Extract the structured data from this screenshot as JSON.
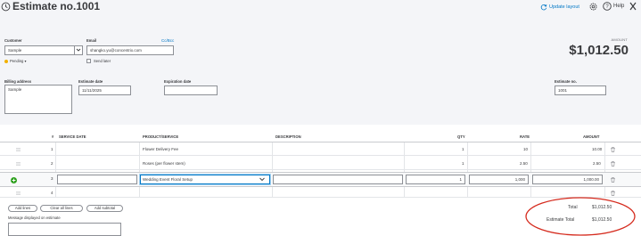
{
  "header": {
    "title": "Estimate no.1001",
    "update_layout": "Update layout",
    "help": "Help"
  },
  "form": {
    "customer_label": "Customer",
    "customer_value": "Sample",
    "email_label": "Email",
    "email_value": "shangko.yu@concentrix.com",
    "cc_bcc": "Cc/Bcc",
    "status": "Pending",
    "send_later": "Send later",
    "amount_label": "AMOUNT",
    "amount_value": "$1,012.50",
    "billing_label": "Billing address",
    "billing_value": "Sample",
    "estimate_date_label": "Estimate date",
    "estimate_date_value": "11/11/2025",
    "expiration_label": "Expiration date",
    "expiration_value": "",
    "estimate_no_label": "Estimate no.",
    "estimate_no_value": "1001"
  },
  "table": {
    "headers": {
      "num": "#",
      "service_date": "SERVICE DATE",
      "product": "PRODUCT/SERVICE",
      "description": "DESCRIPTION",
      "qty": "QTY",
      "rate": "RATE",
      "amount": "AMOUNT"
    },
    "rows": [
      {
        "num": "1",
        "product": "Flower Delivery Fee",
        "qty": "1",
        "rate": "10",
        "amount": "10.00"
      },
      {
        "num": "2",
        "product": "Roses (per flower stem)",
        "qty": "1",
        "rate": "2.50",
        "amount": "2.50"
      },
      {
        "num": "3",
        "product": "Wedding Event Floral Setup",
        "qty": "1",
        "rate": "1,000",
        "amount": "1,000.00"
      },
      {
        "num": "4",
        "product": "",
        "qty": "",
        "rate": "",
        "amount": ""
      }
    ]
  },
  "buttons": {
    "add_lines": "Add lines",
    "clear_all_lines": "Clear all lines",
    "add_subtotal": "Add subtotal"
  },
  "message_label": "Message displayed on estimate",
  "totals": {
    "total_label": "Total",
    "total_value": "$1,012.50",
    "estimate_total_label": "Estimate Total",
    "estimate_total_value": "$1,012.50"
  },
  "colors": {
    "accent_link": "#0077c5",
    "add_green": "#2ca01c",
    "pending_yellow": "#f2b100",
    "annotation_red": "#d52b1e"
  }
}
